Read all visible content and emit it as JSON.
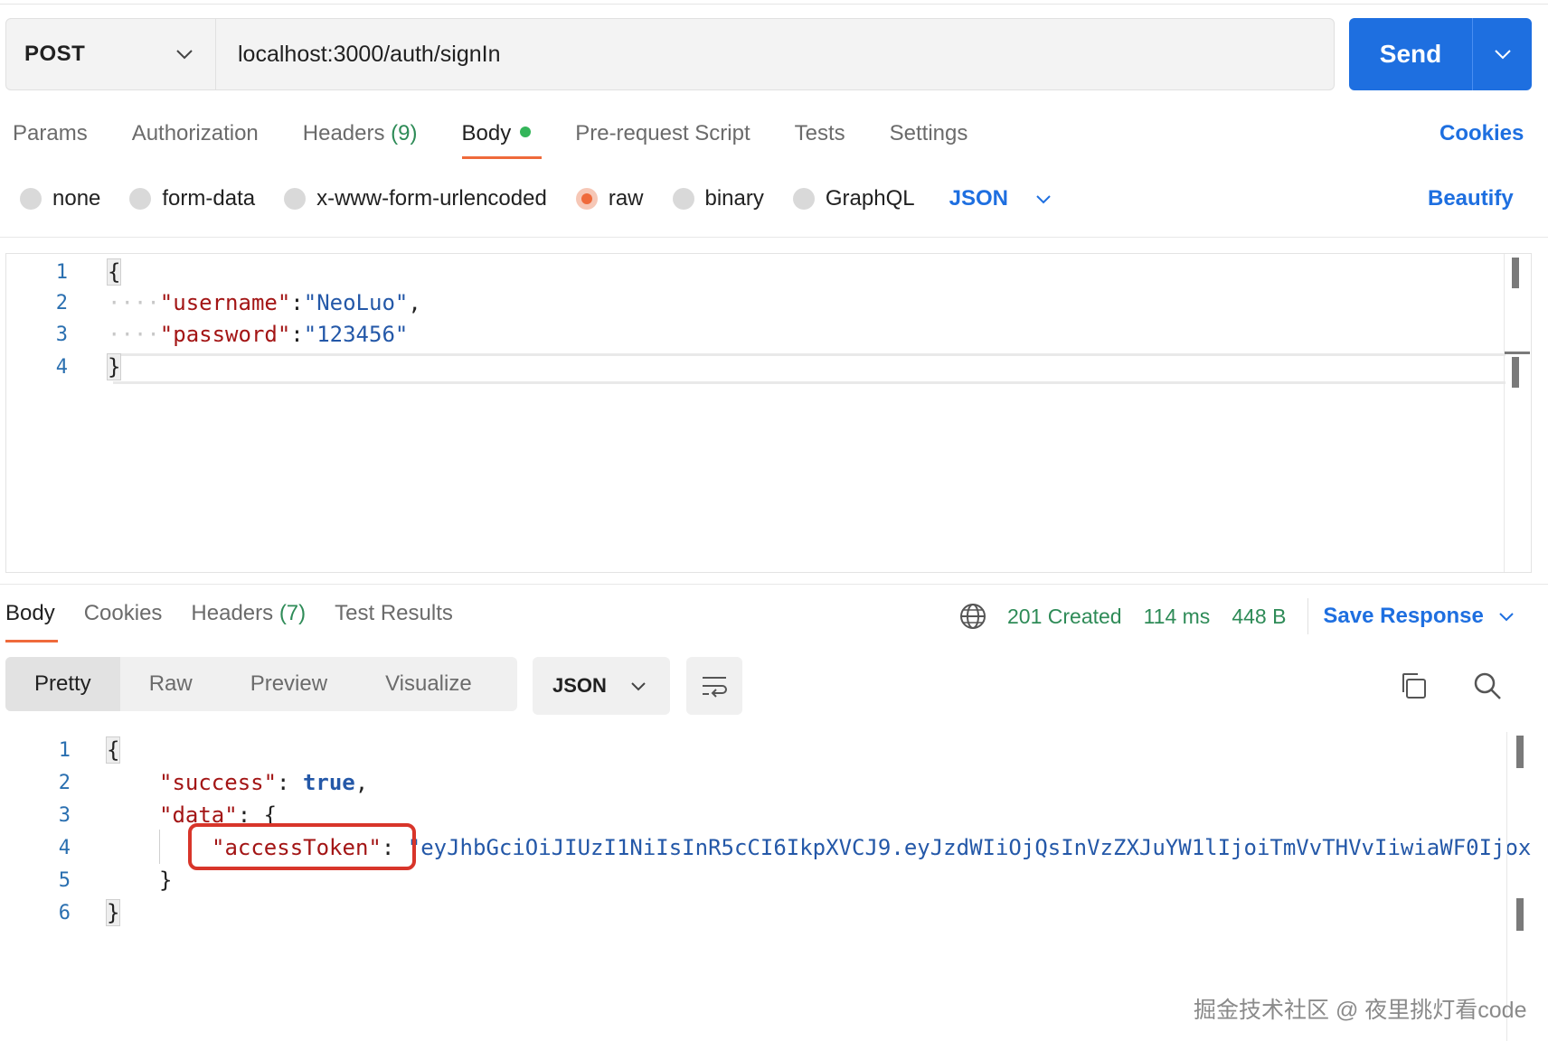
{
  "request": {
    "method": "POST",
    "url": "localhost:3000/auth/signIn",
    "send_label": "Send"
  },
  "request_tabs": {
    "params": "Params",
    "authorization": "Authorization",
    "headers": "Headers",
    "headers_count": "(9)",
    "body": "Body",
    "pre_request": "Pre-request Script",
    "tests": "Tests",
    "settings": "Settings",
    "cookies": "Cookies"
  },
  "body_types": {
    "none": "none",
    "form_data": "form-data",
    "urlencoded": "x-www-form-urlencoded",
    "raw": "raw",
    "binary": "binary",
    "graphql": "GraphQL",
    "format": "JSON",
    "beautify": "Beautify",
    "selected": "raw"
  },
  "request_body": {
    "line_numbers": [
      "1",
      "2",
      "3",
      "4"
    ],
    "open_brace": "{",
    "close_brace": "}",
    "key1": "\"username\"",
    "val1": "\"NeoLuo\"",
    "key2": "\"password\"",
    "val2": "\"123456\"",
    "colon": ":",
    "comma": ","
  },
  "response_tabs": {
    "body": "Body",
    "cookies": "Cookies",
    "headers": "Headers",
    "headers_count": "(7)",
    "test_results": "Test Results"
  },
  "response_status": {
    "status": "201 Created",
    "time": "114 ms",
    "size": "448 B",
    "save_response": "Save Response"
  },
  "response_view": {
    "pretty": "Pretty",
    "raw": "Raw",
    "preview": "Preview",
    "visualize": "Visualize",
    "format": "JSON"
  },
  "response_body": {
    "line_numbers": [
      "1",
      "2",
      "3",
      "4",
      "5",
      "6"
    ],
    "open_brace": "{",
    "close_brace": "}",
    "inner_close": "}",
    "success_key": "\"success\"",
    "success_val": "true",
    "data_key": "\"data\"",
    "data_open": "{",
    "token_key": "\"accessToken\"",
    "token_val": "\"eyJhbGciOiJIUzI1NiIsInR5cCI6IkpXVCJ9.eyJzdWIiOjQsInVzZXJuYW1lIjoiTmVvTHVvIiwiaWF0Ijox"
  },
  "watermark": "掘金技术社区 @ 夜里挑灯看code",
  "colors": {
    "accent_blue": "#1e6fe0",
    "tab_orange": "#ef6a3b",
    "status_green": "#2e8b57",
    "highlight_red": "#d8352a"
  }
}
